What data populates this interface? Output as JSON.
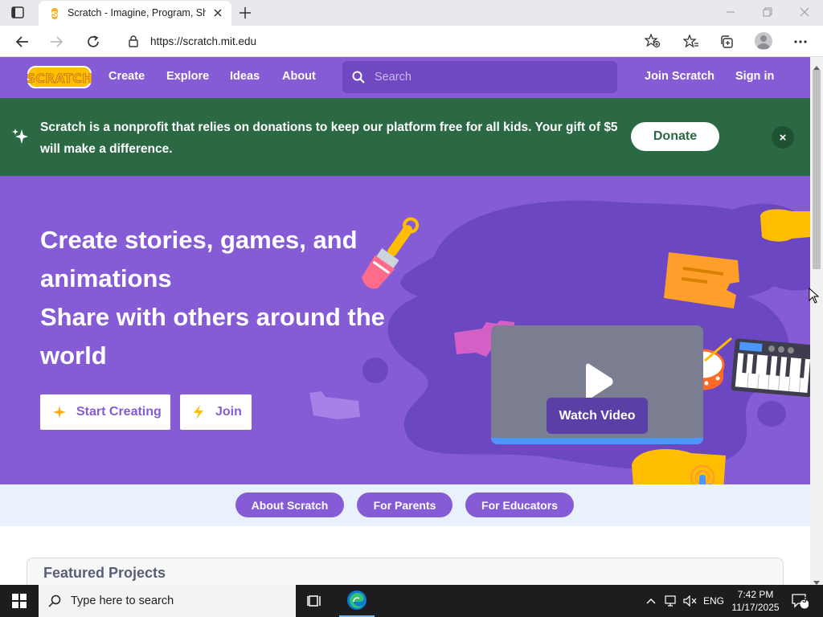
{
  "browser": {
    "tab_title": "Scratch - Imagine, Program, Share",
    "url": "https://scratch.mit.edu"
  },
  "nav": {
    "logo_text": "SCRATCH",
    "links": [
      "Create",
      "Explore",
      "Ideas",
      "About"
    ],
    "search_placeholder": "Search",
    "join": "Join Scratch",
    "signin": "Sign in"
  },
  "banner": {
    "text": "Scratch is a nonprofit that relies on donations to keep our platform free for all kids. Your gift of $5 will make a difference.",
    "donate": "Donate",
    "close": "×"
  },
  "hero": {
    "lines": [
      "Create stories, games, and",
      "animations",
      "Share with others around the",
      "world"
    ],
    "start_creating": "Start Creating",
    "join": "Join",
    "watch_video": "Watch Video"
  },
  "subnav": {
    "pills": [
      "About Scratch",
      "For Parents",
      "For Educators"
    ]
  },
  "featured": {
    "title": "Featured Projects"
  },
  "taskbar": {
    "search_placeholder": "Type here to search",
    "language": "ENG",
    "time": "7:42 PM",
    "date": "11/17/2025",
    "notification_count": "5"
  },
  "colors": {
    "scratch_purple": "#855cd6",
    "banner_green": "#2a6943",
    "scratch_yellow": "#ffbf00"
  }
}
